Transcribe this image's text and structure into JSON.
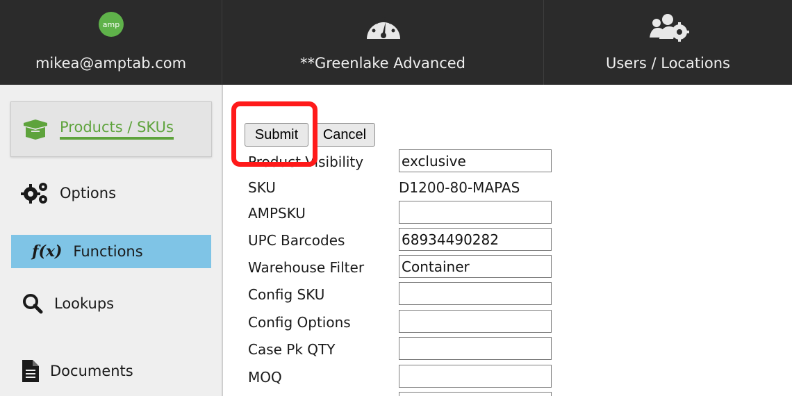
{
  "header": {
    "user_email": "mikea@amptab.com",
    "logo_text": "amp",
    "app_title": "**Greenlake Advanced",
    "users_locations": "Users / Locations",
    "icons": [
      "amp-logo",
      "dashboard-gauge-icon",
      "users-cog-icon"
    ]
  },
  "sidebar": {
    "items": [
      {
        "label": "Products / SKUs",
        "icon": "box-icon",
        "active": true
      },
      {
        "label": "Options",
        "icon": "gears-icon"
      },
      {
        "label": "Functions",
        "icon": "function-icon",
        "icon_text": "f(x)"
      },
      {
        "label": "Lookups",
        "icon": "search-icon"
      },
      {
        "label": "Documents",
        "icon": "document-icon"
      }
    ]
  },
  "form": {
    "submit_label": "Submit",
    "cancel_label": "Cancel",
    "fields": [
      {
        "label": "Product Visibility",
        "value": "exclusive"
      },
      {
        "label": "SKU",
        "value": "D1200-80-MAPAS"
      },
      {
        "label": "AMPSKU",
        "value": ""
      },
      {
        "label": "UPC Barcodes",
        "value": "68934490282"
      },
      {
        "label": "Warehouse Filter",
        "value": "Container"
      },
      {
        "label": "Config SKU",
        "value": ""
      },
      {
        "label": "Config Options",
        "value": ""
      },
      {
        "label": "Case Pk QTY",
        "value": ""
      },
      {
        "label": "MOQ",
        "value": ""
      }
    ]
  },
  "colors": {
    "header_bg": "#2b2b2b",
    "accent_green": "#5ea33c",
    "functions_highlight": "#7fc4e6",
    "annotation_red": "#ff1a1a"
  }
}
